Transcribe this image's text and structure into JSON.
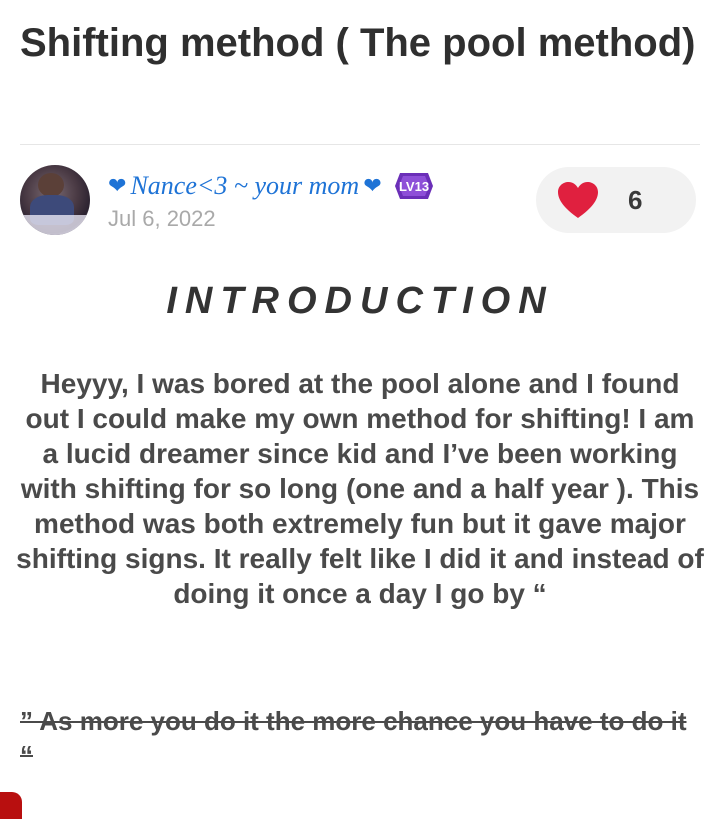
{
  "post": {
    "title": "Shifting method ( The pool method)",
    "author": {
      "heart_left": "❤",
      "name": "Nance<3 ~ your mom",
      "heart_right": "❤",
      "level_badge": "LV13",
      "date": "Jul 6, 2022"
    },
    "likes": {
      "icon": "heart-icon",
      "count": "6"
    },
    "section_heading": "INTRODUCTION",
    "body": "Heyyy, I was bored at the pool alone and I found out I could make my own method for shifting! I am a lucid dreamer since kid and I’ve been working with shifting for so long (one and a half year ). This method was both extremely fun but it gave major shifting signs. It really felt like I did it and instead of doing it once a day I go by “",
    "quote": "” As more you do it the more chance you have to do it “"
  },
  "colors": {
    "author_blue": "#1e73d6",
    "like_red": "#e0203f",
    "badge_purple": "#6b2fb8",
    "date_gray": "#a9a9a9"
  }
}
